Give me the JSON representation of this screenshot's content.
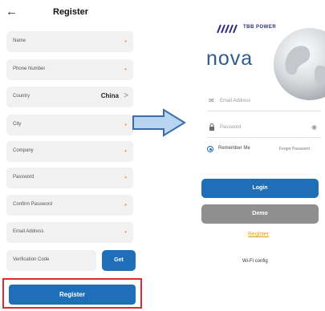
{
  "register": {
    "back_icon": "back-arrow-icon",
    "title": "Register",
    "fields": [
      {
        "label": "Name",
        "required": "•"
      },
      {
        "label": "Phone Number",
        "required": "•"
      },
      {
        "label": "Country",
        "value": "China",
        "chevron": ">"
      },
      {
        "label": "City",
        "required": "•"
      },
      {
        "label": "Company",
        "required": "•"
      },
      {
        "label": "Password",
        "required": "•"
      },
      {
        "label": "Confirm Password",
        "required": "•"
      },
      {
        "label": "Email Address",
        "required": "•"
      }
    ],
    "verification": {
      "label": "Verification Code",
      "button": "Get"
    },
    "submit": "Register",
    "highlight_color": "#e0282a"
  },
  "login": {
    "brand": "TBB POWER",
    "app_name": "nova",
    "email_placeholder": "Email Address",
    "password_placeholder": "Password",
    "remember": "Remember Me",
    "forgot": "Forget Password",
    "login_button": "Login",
    "demo_button": "Demo",
    "register_link": "Register",
    "wifi": "Wi-Fi config"
  },
  "colors": {
    "primary": "#1f6fb8",
    "accent": "#e39a1d",
    "demo": "#8f8f8f"
  }
}
